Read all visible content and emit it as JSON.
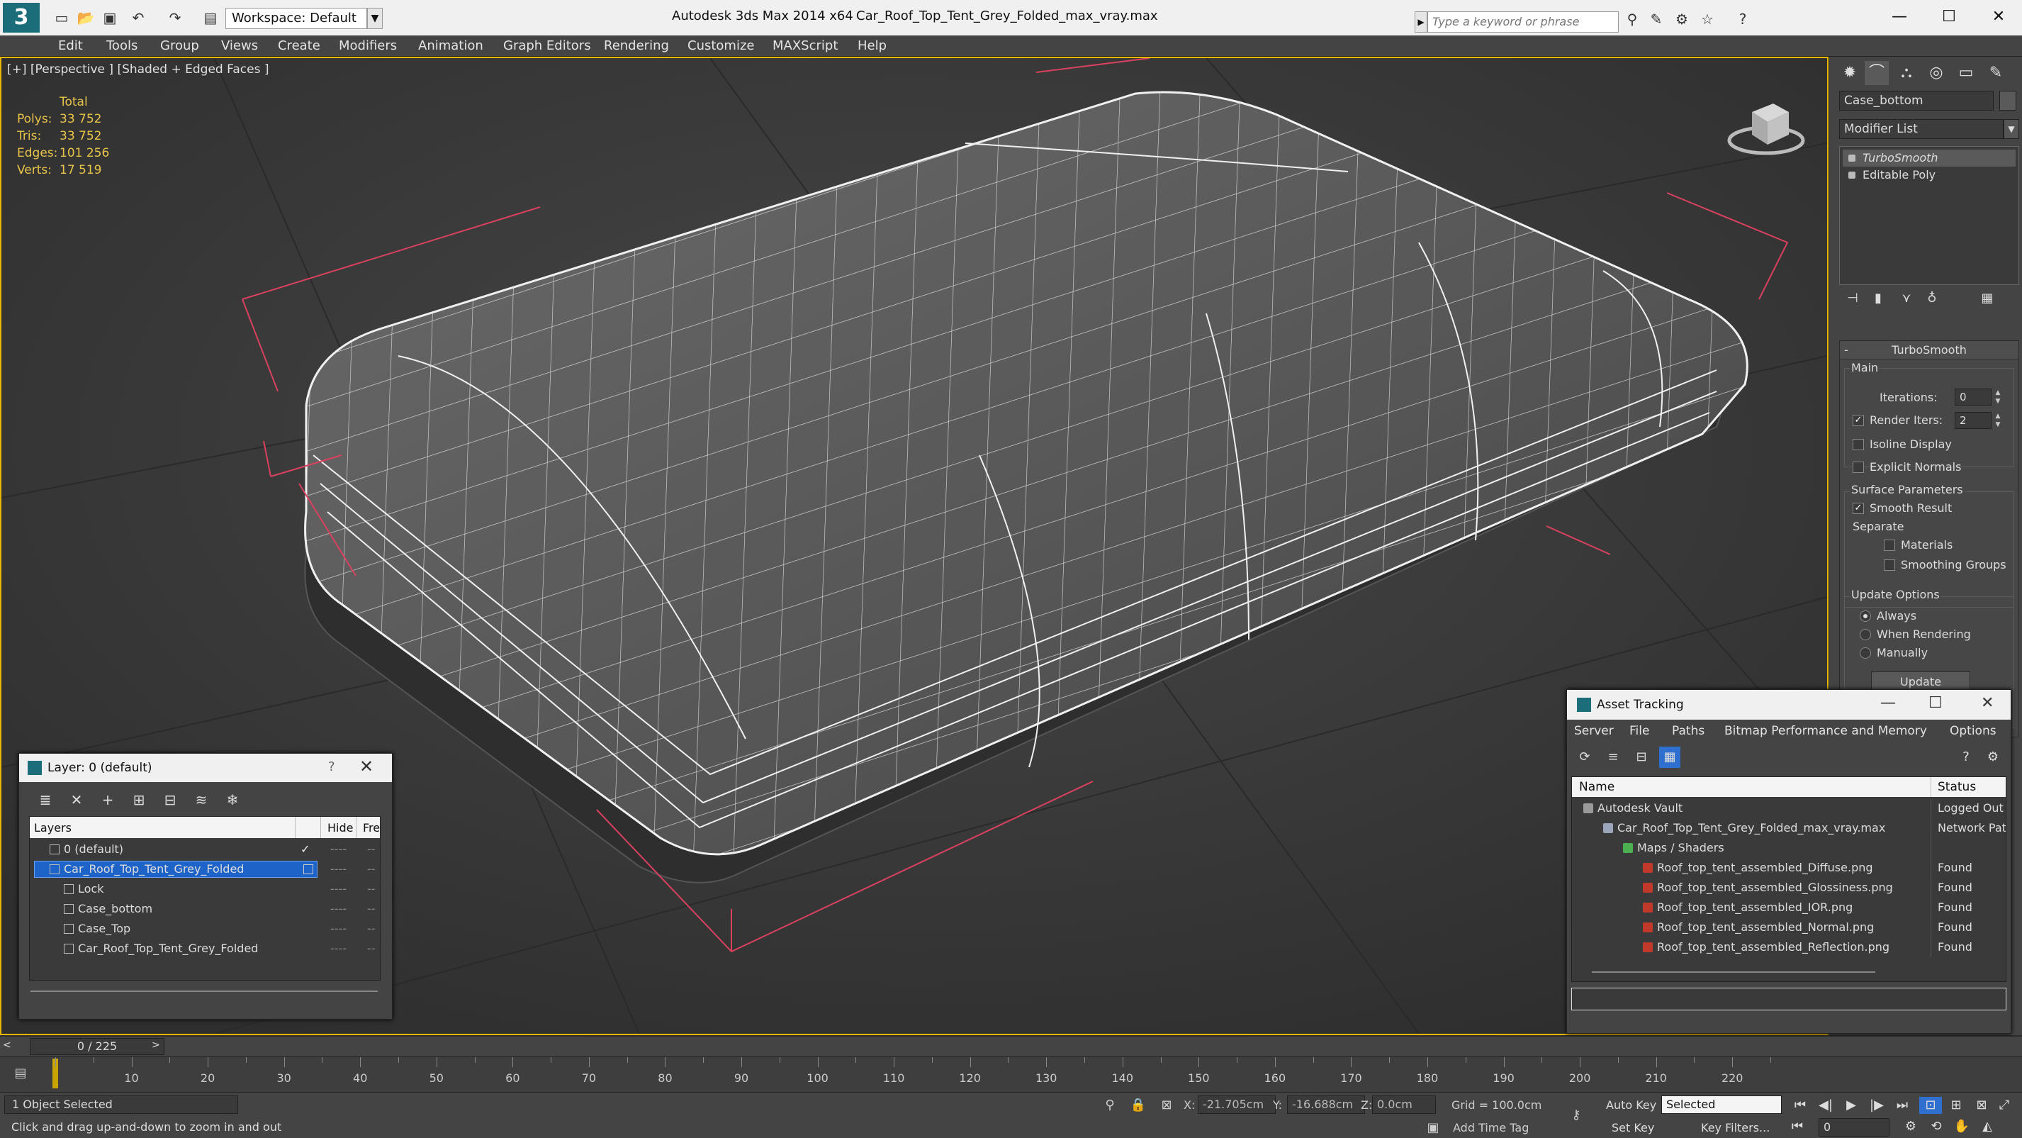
{
  "titlebar": {
    "workspace": "Workspace: Default",
    "app_title": "Autodesk 3ds Max  2014 x64",
    "file_title": "Car_Roof_Top_Tent_Grey_Folded_max_vray.max",
    "search_placeholder": "Type a keyword or phrase",
    "icons": [
      "new-icon",
      "open-icon",
      "save-icon",
      "undo-icon",
      "redo-icon",
      "project-icon"
    ]
  },
  "menu": [
    "Edit",
    "Tools",
    "Group",
    "Views",
    "Create",
    "Modifiers",
    "Animation",
    "Graph Editors",
    "Rendering",
    "Customize",
    "MAXScript",
    "Help"
  ],
  "viewport": {
    "label": "[+] [Perspective ] [Shaded + Edged Faces ]",
    "stats": {
      "total_label": "Total",
      "polys_label": "Polys:",
      "polys": "33 752",
      "tris_label": "Tris:",
      "tris": "33 752",
      "edges_label": "Edges:",
      "edges": "101 256",
      "verts_label": "Verts:",
      "verts": "17 519"
    }
  },
  "command_panel": {
    "object_name": "Case_bottom",
    "modifier_list": "Modifier List",
    "stack": [
      "TurboSmooth",
      "Editable Poly"
    ],
    "rollout": {
      "title": "TurboSmooth",
      "main_label": "Main",
      "iterations_label": "Iterations:",
      "iterations": "0",
      "render_iters_label": "Render Iters:",
      "render_iters": "2",
      "isoline": "Isoline Display",
      "explicit_normals": "Explicit Normals",
      "surface_params": "Surface Parameters",
      "smooth_result": "Smooth Result",
      "separate": "Separate",
      "materials": "Materials",
      "smoothing_groups": "Smoothing Groups",
      "update_options": "Update Options",
      "always": "Always",
      "when_rendering": "When Rendering",
      "manually": "Manually",
      "update_button": "Update"
    }
  },
  "layer_dialog": {
    "title": "Layer: 0 (default)",
    "help": "?",
    "col_layers": "Layers",
    "col_hide": "Hide",
    "col_freeze": "Fre",
    "rows": [
      {
        "name": "0 (default)",
        "indent": 0,
        "selected": false,
        "checked": true
      },
      {
        "name": "Car_Roof_Top_Tent_Grey_Folded",
        "indent": 0,
        "selected": true,
        "checked": false
      },
      {
        "name": "Lock",
        "indent": 1,
        "selected": false,
        "checked": false
      },
      {
        "name": "Case_bottom",
        "indent": 1,
        "selected": false,
        "checked": false
      },
      {
        "name": "Case_Top",
        "indent": 1,
        "selected": false,
        "checked": false
      },
      {
        "name": "Car_Roof_Top_Tent_Grey_Folded",
        "indent": 1,
        "selected": false,
        "checked": false
      }
    ],
    "dash": "----"
  },
  "asset_dialog": {
    "title": "Asset Tracking",
    "menu": [
      "Server",
      "File",
      "Paths",
      "Bitmap Performance and Memory",
      "Options"
    ],
    "col_name": "Name",
    "col_status": "Status",
    "rows": [
      {
        "name": "Autodesk Vault",
        "status": "Logged Out",
        "indent": 0,
        "icon": "#9a9a9a"
      },
      {
        "name": "Car_Roof_Top_Tent_Grey_Folded_max_vray.max",
        "status": "Network Path",
        "indent": 1,
        "icon": "#9aa6b8"
      },
      {
        "name": "Maps / Shaders",
        "status": "",
        "indent": 2,
        "icon": "#4caf50"
      },
      {
        "name": "Roof_top_tent_assembled_Diffuse.png",
        "status": "Found",
        "indent": 3,
        "icon": "#c0392b"
      },
      {
        "name": "Roof_top_tent_assembled_Glossiness.png",
        "status": "Found",
        "indent": 3,
        "icon": "#c0392b"
      },
      {
        "name": "Roof_top_tent_assembled_IOR.png",
        "status": "Found",
        "indent": 3,
        "icon": "#c0392b"
      },
      {
        "name": "Roof_top_tent_assembled_Normal.png",
        "status": "Found",
        "indent": 3,
        "icon": "#c0392b"
      },
      {
        "name": "Roof_top_tent_assembled_Reflection.png",
        "status": "Found",
        "indent": 3,
        "icon": "#c0392b"
      }
    ]
  },
  "timeline": {
    "frame_readout": "0 / 225",
    "left_arrow": "<",
    "right_arrow": ">",
    "ticks": [
      "10",
      "20",
      "30",
      "40",
      "50",
      "60",
      "70",
      "80",
      "90",
      "100",
      "110",
      "120",
      "130",
      "140",
      "150",
      "160",
      "170",
      "180",
      "190",
      "200",
      "210",
      "220"
    ]
  },
  "status": {
    "selection": "1 Object Selected",
    "prompt": "Click and drag up-and-down to zoom in and out",
    "x_label": "X:",
    "x": "-21.705cm",
    "y_label": "Y:",
    "y": "-16.688cm",
    "z_label": "Z:",
    "z": "0.0cm",
    "grid": "Grid = 100.0cm",
    "add_time_tag": "Add Time Tag",
    "auto_key": "Auto Key",
    "set_key": "Set Key",
    "selected_dd": "Selected",
    "key_filters": "Key Filters...",
    "current_frame": "0"
  },
  "colors": {
    "viewport_border": "#e6b800",
    "stats_text": "#e8c34a",
    "selection_highlight": "#1e63c7",
    "wireframe": "#e8e8e8",
    "bbox_corners": "#d9415f"
  }
}
